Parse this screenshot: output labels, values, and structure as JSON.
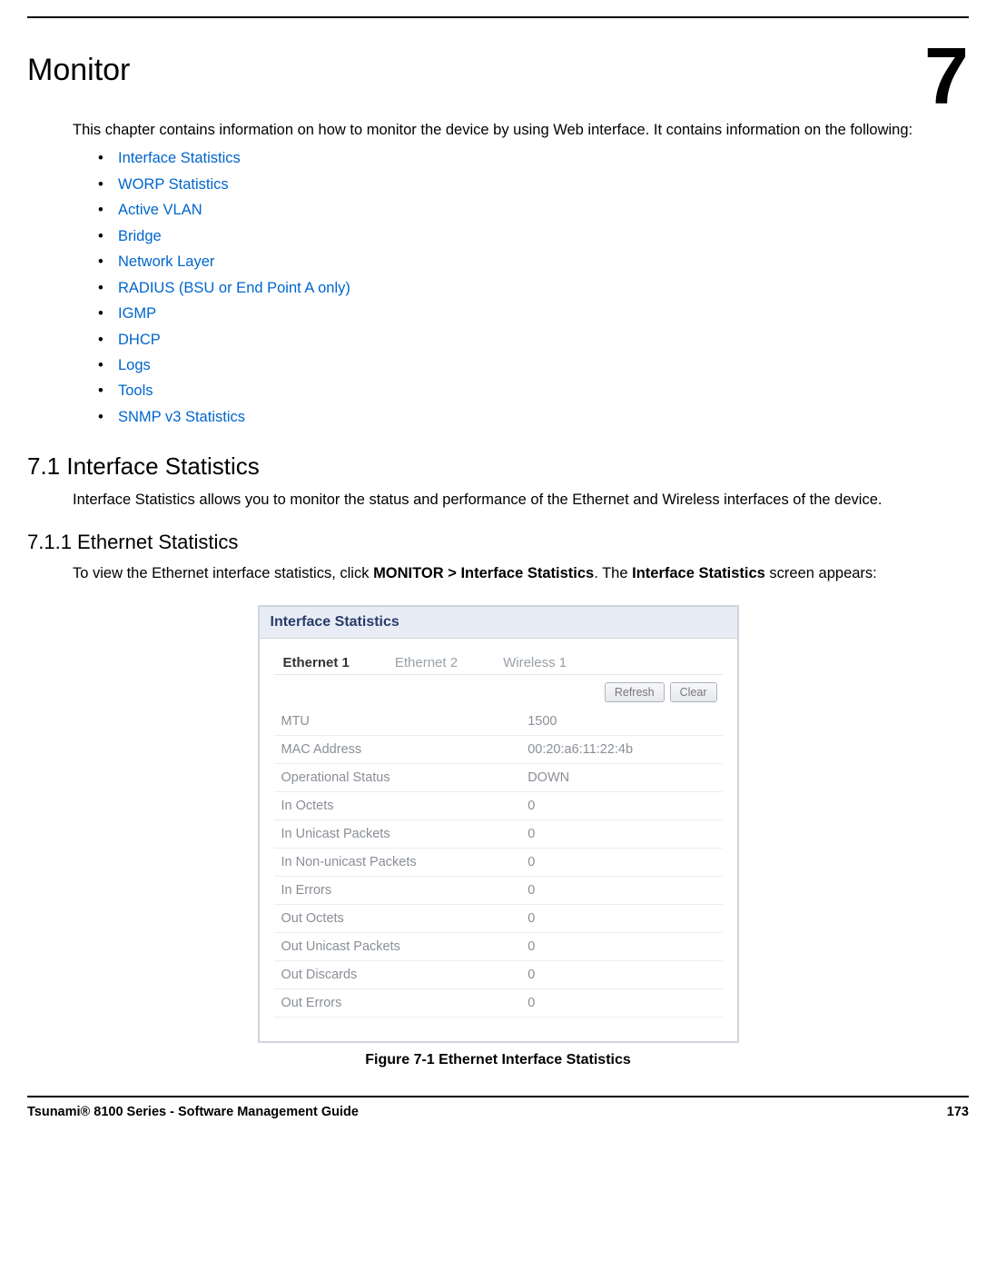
{
  "chapter_num": "7",
  "chapter_title": "Monitor",
  "intro_para": "This chapter contains information on how to monitor the device by using Web interface. It contains information on the following:",
  "toc": [
    "Interface Statistics",
    "WORP Statistics",
    "Active VLAN",
    "Bridge",
    "Network Layer",
    "RADIUS (BSU or End Point A only)",
    "IGMP",
    "DHCP",
    "Logs",
    "Tools",
    "SNMP v3 Statistics"
  ],
  "section_7_1": {
    "heading": "7.1 Interface Statistics",
    "para": "Interface Statistics allows you to monitor the status and performance of the Ethernet and Wireless interfaces of the device."
  },
  "section_7_1_1": {
    "heading": "7.1.1 Ethernet Statistics",
    "para_pre": "To view the Ethernet interface statistics, click ",
    "para_bold1": "MONITOR > Interface Statistics",
    "para_mid": ". The ",
    "para_bold2": "Interface Statistics",
    "para_post": " screen appears:"
  },
  "panel": {
    "title": "Interface Statistics",
    "tabs": [
      "Ethernet 1",
      "Ethernet 2",
      "Wireless 1"
    ],
    "buttons": {
      "refresh": "Refresh",
      "clear": "Clear"
    },
    "rows": [
      {
        "label": "MTU",
        "value": "1500"
      },
      {
        "label": "MAC Address",
        "value": "00:20:a6:11:22:4b"
      },
      {
        "label": "Operational Status",
        "value": "DOWN"
      },
      {
        "label": "In Octets",
        "value": "0"
      },
      {
        "label": "In Unicast Packets",
        "value": "0"
      },
      {
        "label": "In Non-unicast Packets",
        "value": "0"
      },
      {
        "label": "In Errors",
        "value": "0"
      },
      {
        "label": "Out Octets",
        "value": "0"
      },
      {
        "label": "Out Unicast Packets",
        "value": "0"
      },
      {
        "label": "Out Discards",
        "value": "0"
      },
      {
        "label": "Out Errors",
        "value": "0"
      }
    ]
  },
  "figure_caption": "Figure 7-1 Ethernet Interface Statistics",
  "footer": {
    "left": "Tsunami® 8100 Series - Software Management Guide",
    "right": "173"
  }
}
